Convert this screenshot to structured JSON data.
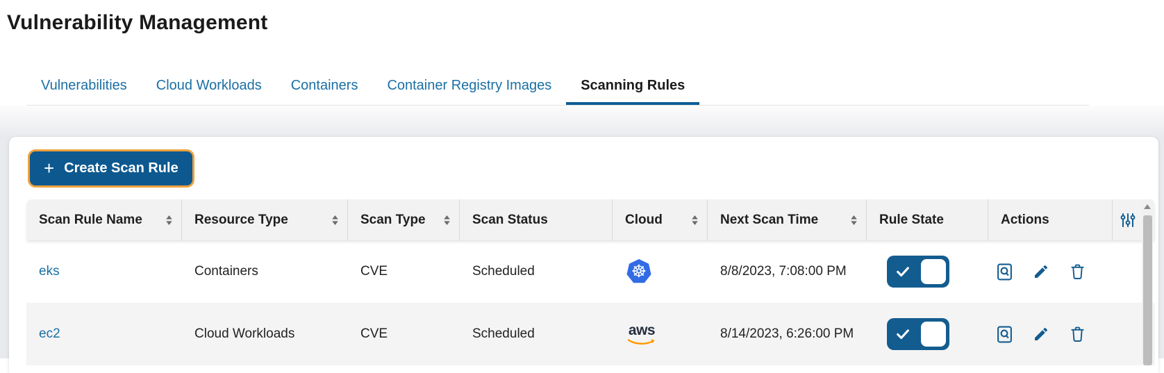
{
  "page": {
    "title": "Vulnerability Management"
  },
  "tabs": [
    {
      "label": "Vulnerabilities",
      "active": false
    },
    {
      "label": "Cloud Workloads",
      "active": false
    },
    {
      "label": "Containers",
      "active": false
    },
    {
      "label": "Container Registry Images",
      "active": false
    },
    {
      "label": "Scanning Rules",
      "active": true
    }
  ],
  "toolbar": {
    "plus_label": "+",
    "create_button_label": "Create Scan Rule"
  },
  "table": {
    "columns": [
      {
        "label": "Scan Rule Name",
        "sortable": true
      },
      {
        "label": "Resource Type",
        "sortable": true
      },
      {
        "label": "Scan Type",
        "sortable": true
      },
      {
        "label": "Scan Status",
        "sortable": false
      },
      {
        "label": "Cloud",
        "sortable": true
      },
      {
        "label": "Next Scan Time",
        "sortable": true
      },
      {
        "label": "Rule State",
        "sortable": false
      },
      {
        "label": "Actions",
        "sortable": false
      }
    ],
    "rows": [
      {
        "name": "eks",
        "resource_type": "Containers",
        "scan_type": "CVE",
        "scan_status": "Scheduled",
        "cloud": "kubernetes",
        "next_scan_time": "8/8/2023, 7:08:00 PM",
        "rule_state_on": true
      },
      {
        "name": "ec2",
        "resource_type": "Cloud Workloads",
        "scan_type": "CVE",
        "scan_status": "Scheduled",
        "cloud": "aws",
        "next_scan_time": "8/14/2023, 6:26:00 PM",
        "rule_state_on": true
      }
    ]
  },
  "icons": {
    "kubernetes_glyph": "☸",
    "aws_label": "aws"
  },
  "colors": {
    "accent_blue": "#135c90",
    "button_blue": "#0d598f",
    "tab_link_blue": "#1a6fa4",
    "active_tab_underline": "#0d5c94",
    "focus_ring_orange": "#eea13c",
    "kubernetes_blue": "#326ce5",
    "aws_orange": "#ff9900",
    "header_bg": "#f2f2f2",
    "row_alt_bg": "#f4f4f4"
  }
}
